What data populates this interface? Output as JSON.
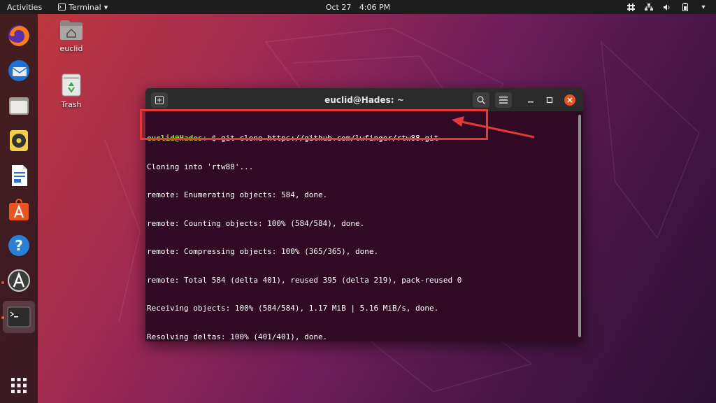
{
  "topbar": {
    "activities": "Activities",
    "app_name": "Terminal",
    "date": "Oct 27",
    "time": "4:06 PM"
  },
  "desktop": {
    "icons": [
      {
        "label": "euclid",
        "icon": "home-folder-icon"
      },
      {
        "label": "Trash",
        "icon": "trash-icon"
      }
    ]
  },
  "dock": {
    "items": [
      "firefox-icon",
      "thunderbird-icon",
      "files-icon",
      "rhythmbox-icon",
      "libreoffice-writer-icon",
      "ubuntu-software-icon",
      "help-icon",
      "software-updater-icon",
      "terminal-icon"
    ],
    "show_apps": "show-applications-icon"
  },
  "terminal": {
    "title": "euclid@Hades: ~",
    "prompt_user": "euclid@Hades",
    "prompt_path": ":~",
    "prompt_symbol": "$ ",
    "command": "git clone https://github.com/lwfinger/rtw88.git",
    "output": [
      "Cloning into 'rtw88'...",
      "remote: Enumerating objects: 584, done.",
      "remote: Counting objects: 100% (584/584), done.",
      "remote: Compressing objects: 100% (365/365), done.",
      "remote: Total 584 (delta 401), reused 395 (delta 219), pack-reused 0",
      "Receiving objects: 100% (584/584), 1.17 MiB | 5.16 MiB/s, done.",
      "Resolving deltas: 100% (401/401), done."
    ]
  },
  "colors": {
    "accent": "#e95420",
    "terminal_bg": "#300a24",
    "prompt_user": "#8ae234",
    "prompt_path": "#729fcf",
    "annotation": "#e53935"
  }
}
